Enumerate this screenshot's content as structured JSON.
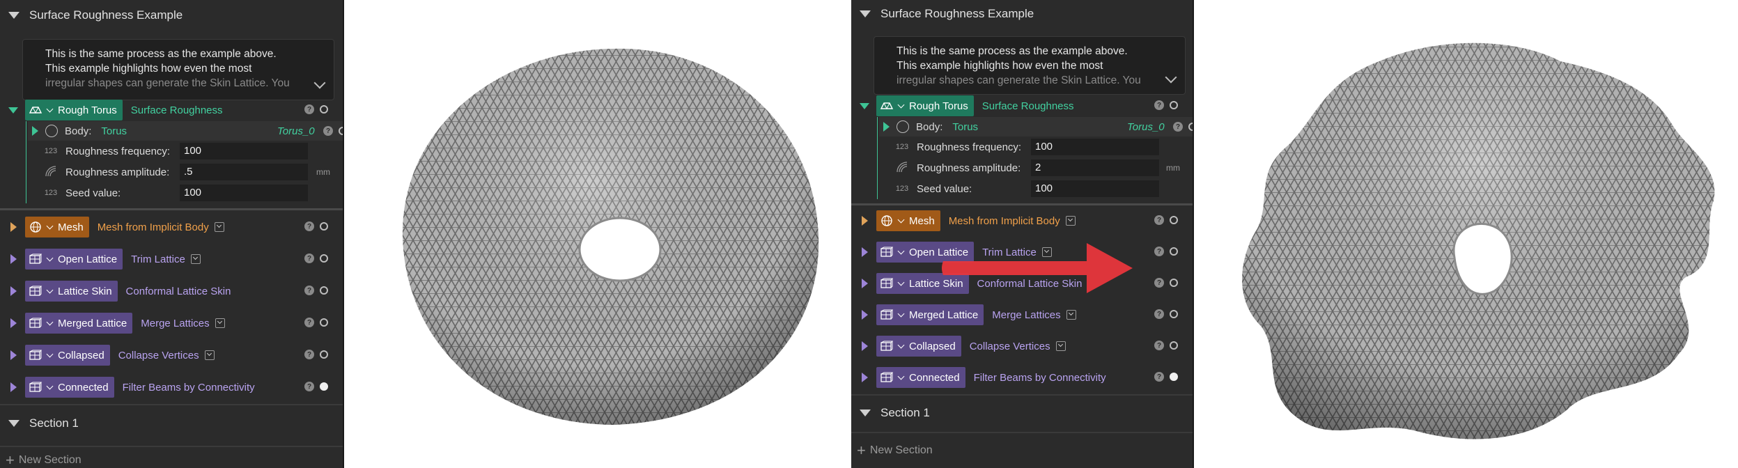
{
  "panels": [
    {
      "section_title": "Surface Roughness Example",
      "description_lines": [
        "This is the same process as the example above.",
        "This example highlights how even the most",
        "irregular shapes can generate the Skin Lattice. You"
      ],
      "rough_torus": {
        "tag": "Rough Torus",
        "op": "Surface Roughness"
      },
      "body": {
        "label": "Body:",
        "value": "Torus",
        "ref": "Torus_0"
      },
      "params": [
        {
          "icon": "123",
          "label": "Roughness frequency:",
          "value": "100",
          "unit": ""
        },
        {
          "icon": "roughness-icon",
          "label": "Roughness amplitude:",
          "value": ".5",
          "unit": "mm"
        },
        {
          "icon": "123",
          "label": "Seed value:",
          "value": "100",
          "unit": ""
        }
      ],
      "ops": [
        {
          "tag": "Mesh",
          "op": "Mesh from Implicit Body",
          "color": "orange",
          "dropdown": true,
          "filled": false
        },
        {
          "tag": "Open Lattice",
          "op": "Trim Lattice",
          "color": "purple",
          "dropdown": true,
          "filled": false
        },
        {
          "tag": "Lattice Skin",
          "op": "Conformal Lattice Skin",
          "color": "purple",
          "dropdown": false,
          "filled": false
        },
        {
          "tag": "Merged Lattice",
          "op": "Merge Lattices",
          "color": "purple",
          "dropdown": true,
          "filled": false
        },
        {
          "tag": "Collapsed",
          "op": "Collapse Vertices",
          "color": "purple",
          "dropdown": true,
          "filled": false
        },
        {
          "tag": "Connected",
          "op": "Filter Beams by Connectivity",
          "color": "purple",
          "dropdown": false,
          "filled": true
        }
      ],
      "section_1": "Section 1",
      "new_section": "New Section"
    },
    {
      "section_title": "Surface Roughness Example",
      "description_lines": [
        "This is the same process as the example above.",
        "This example highlights how even the most",
        "irregular shapes can generate the Skin Lattice. You"
      ],
      "rough_torus": {
        "tag": "Rough Torus",
        "op": "Surface Roughness"
      },
      "body": {
        "label": "Body:",
        "value": "Torus",
        "ref": "Torus_0"
      },
      "params": [
        {
          "icon": "123",
          "label": "Roughness frequency:",
          "value": "100",
          "unit": ""
        },
        {
          "icon": "roughness-icon",
          "label": "Roughness amplitude:",
          "value": "2",
          "unit": "mm"
        },
        {
          "icon": "123",
          "label": "Seed value:",
          "value": "100",
          "unit": ""
        }
      ],
      "ops": [
        {
          "tag": "Mesh",
          "op": "Mesh from Implicit Body",
          "color": "orange",
          "dropdown": true,
          "filled": false
        },
        {
          "tag": "Open Lattice",
          "op": "Trim Lattice",
          "color": "purple",
          "dropdown": true,
          "filled": false
        },
        {
          "tag": "Lattice Skin",
          "op": "Conformal Lattice Skin",
          "color": "purple",
          "dropdown": false,
          "filled": false
        },
        {
          "tag": "Merged Lattice",
          "op": "Merge Lattices",
          "color": "purple",
          "dropdown": true,
          "filled": false
        },
        {
          "tag": "Collapsed",
          "op": "Collapse Vertices",
          "color": "purple",
          "dropdown": true,
          "filled": false
        },
        {
          "tag": "Connected",
          "op": "Filter Beams by Connectivity",
          "color": "purple",
          "dropdown": false,
          "filled": true
        }
      ],
      "section_1": "Section 1",
      "new_section": "New Section"
    }
  ],
  "colors": {
    "panel_bg": "#2b2b2b",
    "green": "#42d1a0",
    "orange": "#f0a04a",
    "purple": "#b9a3f0",
    "arrow": "#e8363c",
    "lattice": "#9a9a9a"
  },
  "help_glyph": "?"
}
